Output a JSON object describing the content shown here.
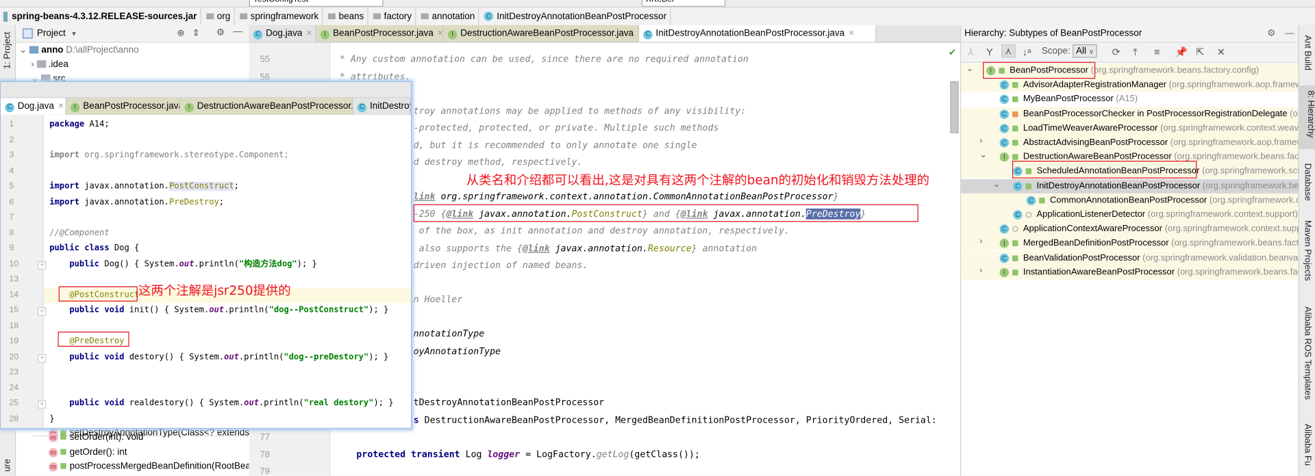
{
  "toolbar": {
    "run_config": "TestConfigTest",
    "user_config": "XKeBer"
  },
  "breadcrumb": [
    "spring-beans-4.3.12.RELEASE-sources.jar",
    "org",
    "springframework",
    "beans",
    "factory",
    "annotation",
    "InitDestroyAnnotationBeanPostProcessor"
  ],
  "left_strip": {
    "project": "1: Project",
    "structure": "ure"
  },
  "project": {
    "title": "Project",
    "tree": [
      {
        "name": "anno",
        "path": "D:\\allProject\\anno"
      },
      {
        "name": ".idea",
        "path": ""
      },
      {
        "name": "src",
        "path": ""
      }
    ],
    "structure_items": [
      "setDestroyAnnotationType(Class<? extends An",
      "setOrder(int): void",
      "getOrder(): int",
      "postProcessMergedBeanDefinition(RootBeanI"
    ]
  },
  "editor": {
    "tabs": [
      {
        "label": "Dog.java",
        "icon": "C"
      },
      {
        "label": "BeanPostProcessor.java",
        "icon": "I"
      },
      {
        "label": "DestructionAwareBeanPostProcessor.java",
        "icon": "I"
      },
      {
        "label": "InitDestroyAnnotationBeanPostProcessor.java",
        "icon": "C",
        "active": true
      }
    ],
    "line_numbers": [
      {
        "n": "55",
        "line": 55
      },
      {
        "n": "56",
        "line": 56
      },
      {
        "n": "77",
        "line": 77
      },
      {
        "n": "78",
        "line": 78
      },
      {
        "n": "79",
        "line": 79
      }
    ],
    "lines": [
      {
        "line": 55,
        "start": "full",
        "tokens": [
          [
            "cm",
            "* Any custom annotation can be used, since there are no required annotation"
          ]
        ]
      },
      {
        "line": 56,
        "start": "full",
        "tokens": [
          [
            "cm",
            "* attributes."
          ]
        ]
      },
      {
        "line": 58,
        "tokens": [
          [
            "cm",
            "troy annotations may be applied to methods of any visibility:"
          ]
        ]
      },
      {
        "line": 59,
        "tokens": [
          [
            "cm",
            "-protected, protected, or private. Multiple such methods"
          ]
        ]
      },
      {
        "line": 60,
        "tokens": [
          [
            "cm",
            "d, but it is recommended to only annotate one single"
          ]
        ]
      },
      {
        "line": 61,
        "tokens": [
          [
            "cm",
            "d destroy method, respectively."
          ]
        ]
      },
      {
        "line": 63,
        "tokens": [
          [
            "doctag",
            "link"
          ],
          [
            "docref",
            " org.springframework.context.annotation.CommonAnnotationBeanPostProcessor"
          ],
          [
            "cm",
            "}"
          ]
        ]
      },
      {
        "line": 64,
        "tokens": [
          [
            "cm",
            "-250 {"
          ],
          [
            "doctag",
            "@link"
          ],
          [
            "docref",
            " javax.annotation."
          ],
          [
            "docann",
            "PostConstruct"
          ],
          [
            "cm",
            "} and {"
          ],
          [
            "doctag",
            "@link"
          ],
          [
            "docref",
            " javax.annotation."
          ],
          [
            "sel",
            "PreDestroy"
          ],
          [
            "cm",
            "}"
          ]
        ]
      },
      {
        "line": 65,
        "tokens": [
          [
            "cm",
            " of the box, as init annotation and destroy annotation, respectively."
          ]
        ]
      },
      {
        "line": 66,
        "tokens": [
          [
            "cm",
            " also supports the {"
          ],
          [
            "doctag",
            "@link"
          ],
          [
            "docref",
            " javax.annotation."
          ],
          [
            "docann",
            "Resource"
          ],
          [
            "cm",
            "} annotation"
          ]
        ]
      },
      {
        "line": 67,
        "tokens": [
          [
            "cm",
            "driven injection of named beans."
          ]
        ]
      },
      {
        "line": 69,
        "tokens": [
          [
            "cm",
            "n Hoeller"
          ]
        ]
      },
      {
        "line": 71,
        "tokens": [
          [
            "docref",
            "nnotationType"
          ]
        ]
      },
      {
        "line": 72,
        "tokens": [
          [
            "docref",
            "oyAnnotationType"
          ]
        ]
      },
      {
        "line": 75,
        "tokens": [
          [
            "pl",
            "tDestroyAnnotationBeanPostProcessor"
          ]
        ]
      },
      {
        "line": 76,
        "tokens": [
          [
            "kw",
            "s"
          ],
          [
            "pl",
            " DestructionAwareBeanPostProcessor, MergedBeanDefinitionPostProcessor, PriorityOrdered, Serial:"
          ]
        ]
      },
      {
        "line": 78,
        "start": "indent",
        "tokens": [
          [
            "kw",
            "protected transient "
          ],
          [
            "pl",
            "Log "
          ],
          [
            "fld",
            "logger"
          ],
          [
            "pl",
            " = LogFactory."
          ],
          [
            "stat",
            "getLog"
          ],
          [
            "pl",
            "(getClass());"
          ]
        ]
      }
    ]
  },
  "popup": {
    "tabs": [
      {
        "label": "Dog.java",
        "icon": "C",
        "active": true
      },
      {
        "label": "BeanPostProcessor.java",
        "icon": "I"
      },
      {
        "label": "DestructionAwareBeanPostProcessor.java",
        "icon": "I"
      },
      {
        "label": "InitDestroyAnnota",
        "icon": "C"
      }
    ],
    "lines": [
      {
        "n": "1",
        "tokens": [
          [
            "kw",
            "package"
          ],
          [
            "pl",
            " A14;"
          ]
        ]
      },
      {
        "n": "2",
        "tokens": []
      },
      {
        "n": "3",
        "tokens": [
          [
            "unusedkw",
            "import"
          ],
          [
            "unused",
            " org.springframework.stereotype.Component;"
          ]
        ]
      },
      {
        "n": "4",
        "tokens": []
      },
      {
        "n": "5",
        "tokens": [
          [
            "kw",
            "import"
          ],
          [
            "pl",
            " javax.annotation."
          ],
          [
            "ann hlb",
            "PostConstruct"
          ],
          [
            "pl",
            ";"
          ]
        ]
      },
      {
        "n": "6",
        "tokens": [
          [
            "kw",
            "import"
          ],
          [
            "pl",
            " javax.annotation."
          ],
          [
            "ann",
            "PreDestroy"
          ],
          [
            "pl",
            ";"
          ]
        ]
      },
      {
        "n": "7",
        "tokens": []
      },
      {
        "n": "8",
        "tokens": [
          [
            "cm",
            "//@Component"
          ]
        ]
      },
      {
        "n": "9",
        "tokens": [
          [
            "kw",
            "public class"
          ],
          [
            "pl",
            " Dog {"
          ]
        ]
      },
      {
        "n": "10",
        "fold": true,
        "tokens": [
          [
            "pl",
            "    "
          ],
          [
            "kw",
            "public"
          ],
          [
            "pl",
            " Dog() { System."
          ],
          [
            "fld",
            "out"
          ],
          [
            "pl",
            ".println("
          ],
          [
            "str",
            "\"构造方法dog\""
          ],
          [
            "pl",
            "); }"
          ]
        ]
      },
      {
        "n": "13",
        "tokens": []
      },
      {
        "n": "14",
        "current": true,
        "tokens": [
          [
            "pl",
            "    "
          ],
          [
            "ann",
            "@PostConstruct"
          ]
        ]
      },
      {
        "n": "15",
        "fold": true,
        "tokens": [
          [
            "pl",
            "    "
          ],
          [
            "kw",
            "public void"
          ],
          [
            "pl",
            " init() { System."
          ],
          [
            "fld",
            "out"
          ],
          [
            "pl",
            ".println("
          ],
          [
            "str",
            "\"dog--PostConstruct\""
          ],
          [
            "pl",
            "); }"
          ]
        ]
      },
      {
        "n": "18",
        "tokens": []
      },
      {
        "n": "19",
        "tokens": [
          [
            "pl",
            "    "
          ],
          [
            "ann",
            "@PreDestroy"
          ]
        ]
      },
      {
        "n": "20",
        "fold": true,
        "tokens": [
          [
            "pl",
            "    "
          ],
          [
            "kw",
            "public void"
          ],
          [
            "pl",
            " destory() { System."
          ],
          [
            "fld",
            "out"
          ],
          [
            "pl",
            ".println("
          ],
          [
            "str",
            "\"dog--preDestory\""
          ],
          [
            "pl",
            "); }"
          ]
        ]
      },
      {
        "n": "23",
        "tokens": []
      },
      {
        "n": "24",
        "tokens": []
      },
      {
        "n": "25",
        "fold": true,
        "tokens": [
          [
            "pl",
            "    "
          ],
          [
            "kw",
            "public void"
          ],
          [
            "pl",
            " realdestory() { System."
          ],
          [
            "fld",
            "out"
          ],
          [
            "pl",
            ".println("
          ],
          [
            "str",
            "\"real destory\""
          ],
          [
            "pl",
            "); }"
          ]
        ]
      },
      {
        "n": "28",
        "tokens": [
          [
            "pl",
            "}"
          ]
        ]
      }
    ]
  },
  "hierarchy": {
    "title": "Hierarchy:  Subtypes of BeanPostProcessor",
    "scope_label": "Scope:",
    "scope_value": "All",
    "rows": [
      {
        "name": "BeanPostProcessor",
        "pkg": "(org.springframework.beans.factory.config)",
        "level": 0,
        "kind": "I",
        "toggle": "open",
        "lib": true
      },
      {
        "name": "AdvisorAdapterRegistrationManager",
        "pkg": "(org.springframework.aop.framework",
        "level": 1,
        "kind": "C",
        "lib": true
      },
      {
        "name": "MyBeanPostProcessor",
        "pkg": "(A15)",
        "level": 1,
        "kind": "C",
        "lib": false
      },
      {
        "name": "BeanPostProcessorChecker in PostProcessorRegistrationDelegate",
        "pkg": "(org.s",
        "level": 1,
        "kind": "C",
        "lock": "private",
        "lib": true
      },
      {
        "name": "LoadTimeWeaverAwareProcessor",
        "pkg": "(org.springframework.context.weaving",
        "level": 1,
        "kind": "C",
        "lib": true
      },
      {
        "name": "AbstractAdvisingBeanPostProcessor",
        "pkg": "(org.springframework.aop.framewo",
        "level": 1,
        "kind": "C",
        "toggle": "closed",
        "lib": true
      },
      {
        "name": "DestructionAwareBeanPostProcessor",
        "pkg": "(org.springframework.beans.factor",
        "level": 1,
        "kind": "I",
        "toggle": "open",
        "lib": true
      },
      {
        "name": "ScheduledAnnotationBeanPostProcessor",
        "pkg": "(org.springframework.sched",
        "level": 2,
        "kind": "C",
        "lib": true
      },
      {
        "name": "InitDestroyAnnotationBeanPostProcessor",
        "pkg": "(org.springframework.bean",
        "level": 2,
        "kind": "C",
        "toggle": "open",
        "selected": true,
        "lib": true
      },
      {
        "name": "CommonAnnotationBeanPostProcessor",
        "pkg": "(org.springframework.con",
        "level": 3,
        "kind": "C",
        "lib": true
      },
      {
        "name": "ApplicationListenerDetector",
        "pkg": "(org.springframework.context.support)",
        "level": 2,
        "kind": "C",
        "lock": "package",
        "lib": true
      },
      {
        "name": "ApplicationContextAwareProcessor",
        "pkg": "(org.springframework.context.suppo",
        "level": 1,
        "kind": "C",
        "lock": "package",
        "lib": true
      },
      {
        "name": "MergedBeanDefinitionPostProcessor",
        "pkg": "(org.springframework.beans.factor",
        "level": 1,
        "kind": "I",
        "toggle": "closed",
        "lib": true
      },
      {
        "name": "BeanValidationPostProcessor",
        "pkg": "(org.springframework.validation.beanvalid",
        "level": 1,
        "kind": "C",
        "lib": true
      },
      {
        "name": "InstantiationAwareBeanPostProcessor",
        "pkg": "(org.springframework.beans.facto",
        "level": 1,
        "kind": "I",
        "toggle": "closed",
        "lib": true
      }
    ]
  },
  "right_strip": [
    "Ant Build",
    "8: Hierarchy",
    "Database",
    "Maven Projects",
    "Alibaba ROS Templates",
    "Alibaba Fu"
  ],
  "annotations": {
    "editor_note": "从类名和介绍都可以看出,这是对具有这两个注解的bean的初始化和销毁方法处理的",
    "popup_note": "这两个注解是jsr250提供的"
  },
  "colors": {
    "annotation_red": "#e0121b",
    "keyword": "#000080",
    "string": "#008000",
    "selection": "#5a6ea8",
    "class_icon": "#6ec6e0",
    "interface_icon": "#9cc97a"
  }
}
